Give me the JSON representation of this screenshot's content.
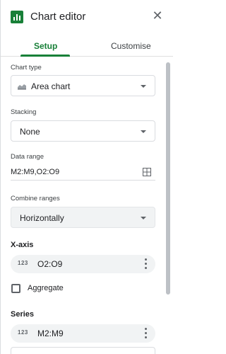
{
  "header": {
    "title": "Chart editor",
    "close_icon": "close-icon"
  },
  "tabs": [
    {
      "label": "Setup",
      "active": true
    },
    {
      "label": "Customise",
      "active": false
    }
  ],
  "colors": {
    "accent": "#188038"
  },
  "fields": {
    "chart_type": {
      "label": "Chart type",
      "value": "Area chart",
      "icon": "area-chart-icon"
    },
    "stacking": {
      "label": "Stacking",
      "value": "None"
    },
    "data_range": {
      "label": "Data range",
      "value": "M2:M9,O2:O9",
      "icon": "grid-select-icon"
    },
    "combine_ranges": {
      "label": "Combine ranges",
      "value": "Horizontally"
    }
  },
  "x_axis": {
    "title": "X-axis",
    "item": {
      "type_badge": "123",
      "value": "O2:O9"
    }
  },
  "aggregate": {
    "label": "Aggregate",
    "checked": false
  },
  "series": {
    "title": "Series",
    "item": {
      "type_badge": "123",
      "value": "M2:M9"
    }
  }
}
